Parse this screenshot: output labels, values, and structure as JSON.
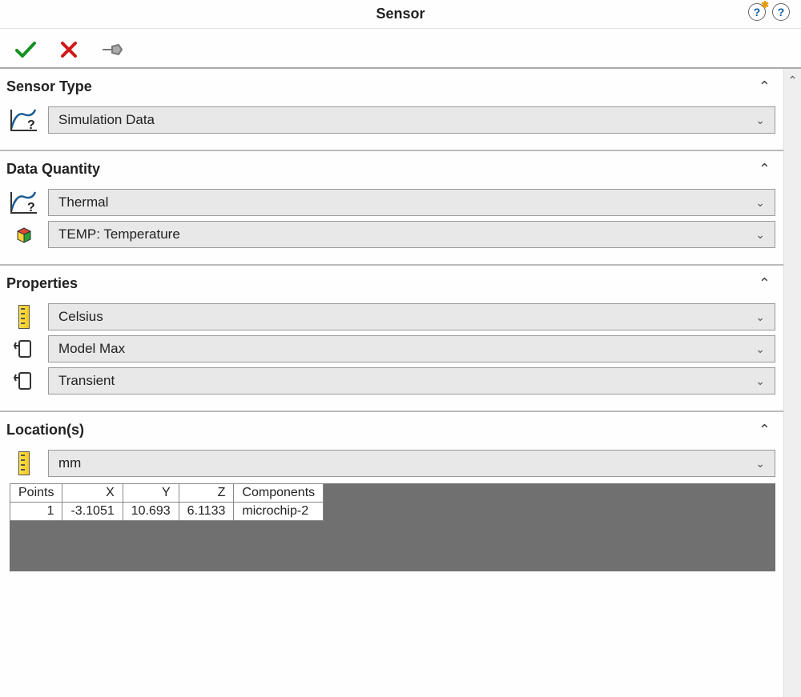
{
  "header": {
    "title": "Sensor"
  },
  "sections": {
    "sensor_type": {
      "title": "Sensor Type",
      "value": "Simulation Data"
    },
    "data_quantity": {
      "title": "Data Quantity",
      "category": "Thermal",
      "quantity": "TEMP: Temperature"
    },
    "properties": {
      "title": "Properties",
      "unit": "Celsius",
      "criterion": "Model Max",
      "step": "Transient"
    },
    "locations": {
      "title": "Location(s)",
      "unit": "mm",
      "columns": {
        "points": "Points",
        "x": "X",
        "y": "Y",
        "z": "Z",
        "components": "Components"
      },
      "rows": [
        {
          "idx": "1",
          "x": "-3.1051",
          "y": "10.693",
          "z": "6.1133",
          "component": "microchip-2"
        }
      ]
    }
  }
}
